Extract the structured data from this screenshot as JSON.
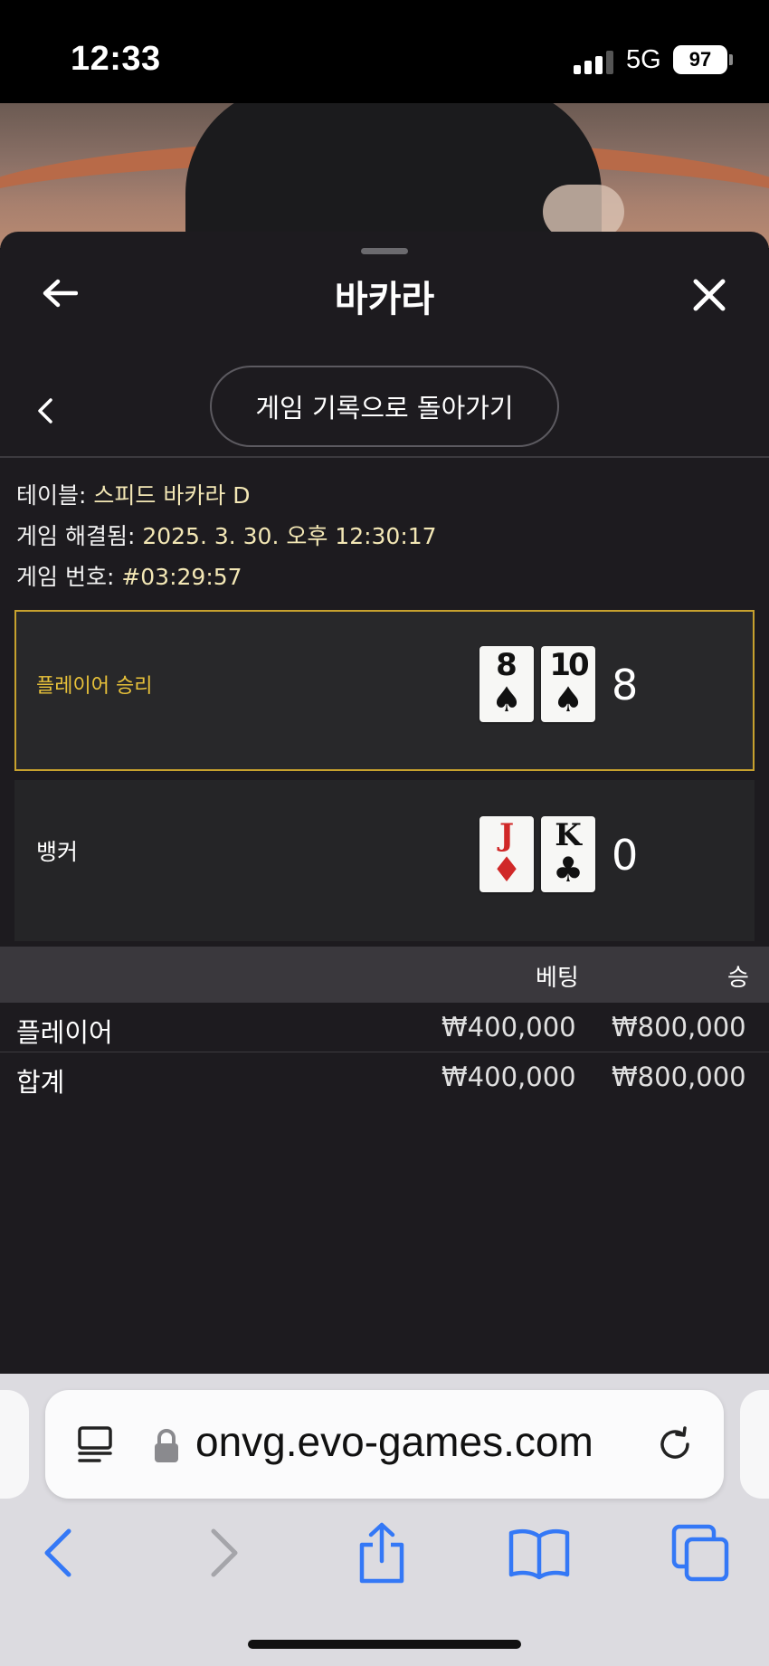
{
  "status_bar": {
    "time": "12:33",
    "network": "5G",
    "battery": "97"
  },
  "header": {
    "title": "바카라"
  },
  "nav": {
    "back_to_history": "게임 기록으로 돌아가기"
  },
  "info": {
    "table_label": "테이블:",
    "table_value": "스피드 바카라 D",
    "resolved_label": "게임 해결됨:",
    "resolved_value": "2025. 3. 30. 오후 12:30:17",
    "game_no_label": "게임 번호:",
    "game_no_value": "#03:29:57"
  },
  "results": {
    "player": {
      "label": "플레이어 승리",
      "score": "8",
      "highlight_color": "#c7a12e",
      "cards": [
        {
          "rank": "8",
          "suit": "♠",
          "color": "black"
        },
        {
          "rank": "10",
          "suit": "♠",
          "color": "black"
        }
      ]
    },
    "banker": {
      "label": "뱅커",
      "score": "0",
      "cards": [
        {
          "rank": "J",
          "suit": "♦",
          "color": "red"
        },
        {
          "rank": "K",
          "suit": "♣",
          "color": "black"
        }
      ]
    }
  },
  "bets": {
    "headers": {
      "bet": "베팅",
      "win": "승"
    },
    "rows": [
      {
        "name": "플레이어",
        "bet": "₩400,000",
        "win": "₩800,000"
      },
      {
        "name": "합계",
        "bet": "₩400,000",
        "win": "₩800,000"
      }
    ]
  },
  "browser": {
    "url": "onvg.evo-games.com",
    "accent": "#3478f6"
  }
}
